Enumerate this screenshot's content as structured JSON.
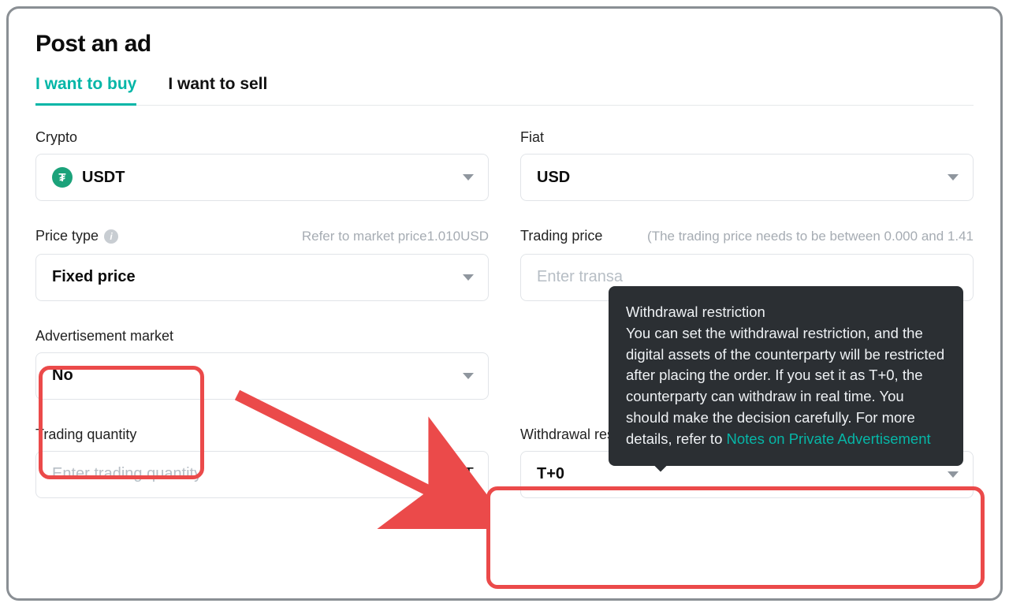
{
  "page_title": "Post an ad",
  "tabs": {
    "buy": "I want to buy",
    "sell": "I want to sell"
  },
  "crypto": {
    "label": "Crypto",
    "value": "USDT",
    "icon_letter": "₮"
  },
  "fiat": {
    "label": "Fiat",
    "value": "USD"
  },
  "price_type": {
    "label": "Price type",
    "hint": "Refer to market price1.010USD",
    "value": "Fixed price"
  },
  "trading_price": {
    "label": "Trading price",
    "hint": "(The trading price needs to be between 0.000 and 1.41",
    "placeholder": "Enter transa"
  },
  "ad_market": {
    "label": "Advertisement market",
    "value": "No"
  },
  "trading_quantity": {
    "label": "Trading quantity",
    "placeholder": "Enter trading quantity",
    "suffix": "USDT"
  },
  "withdrawal": {
    "label": "Withdrawal restriction",
    "value": "T+0"
  },
  "tooltip": {
    "title": "Withdrawal restriction",
    "body": "You can set the withdrawal restriction, and the digital assets of the counterparty will be restricted after placing the order. If you set it as T+0, the counterparty can withdraw in real time. You should make the decision carefully. For more details, refer to ",
    "link": "Notes on Private Advertisement"
  }
}
